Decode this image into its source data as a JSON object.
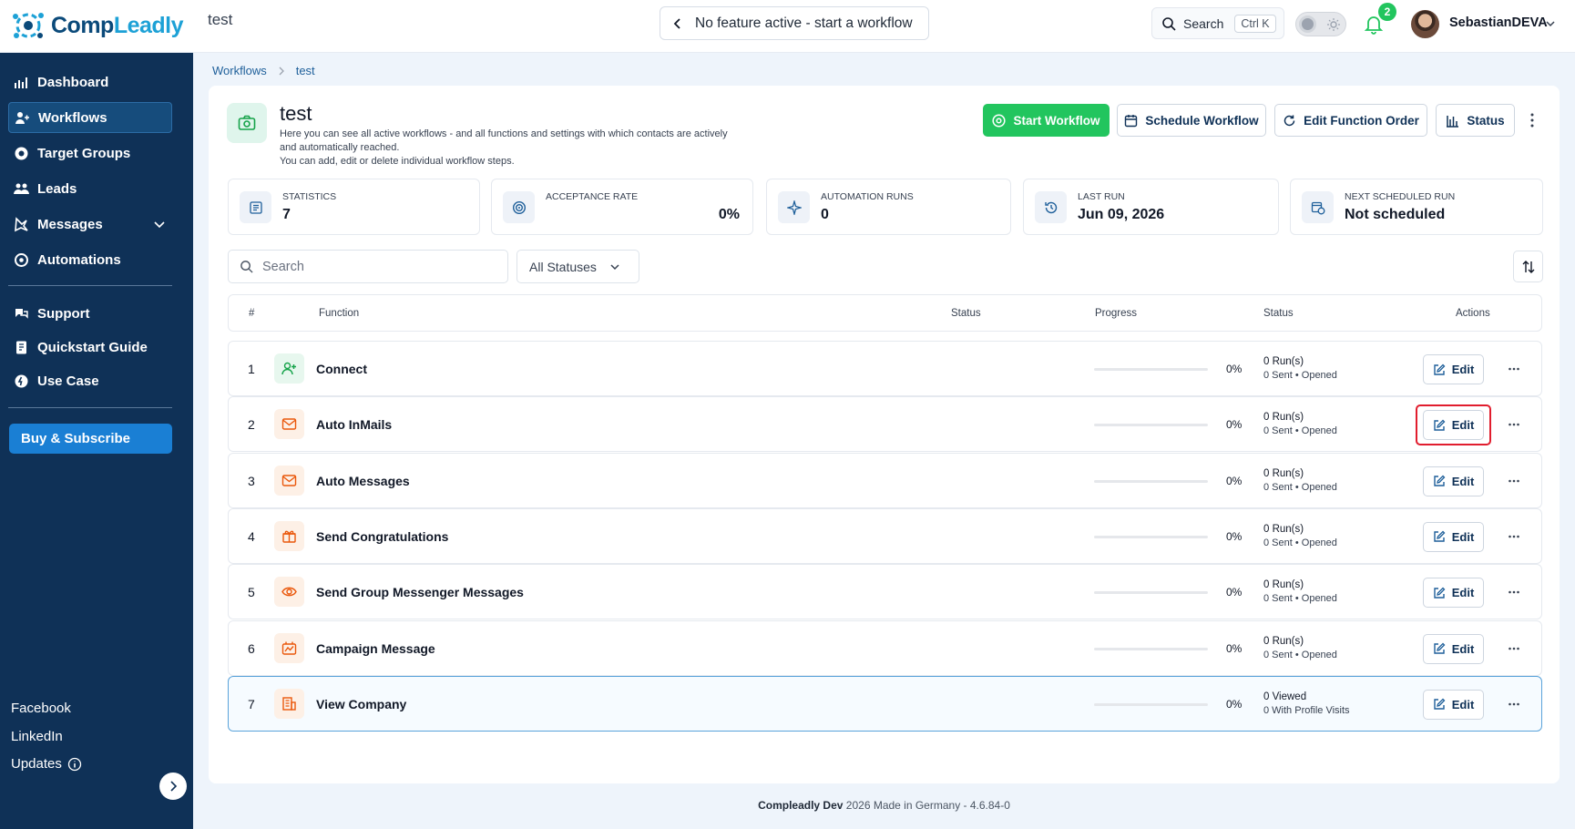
{
  "app": {
    "logo_prefix": "Comp",
    "logo_suffix": "Leadly",
    "page_name": "test"
  },
  "topbar": {
    "feature_status": "No feature active - start a workflow",
    "search_label": "Search",
    "search_shortcut": "Ctrl K",
    "notification_count": "2",
    "username": "SebastianDEVA"
  },
  "sidebar": {
    "items": [
      {
        "label": "Dashboard",
        "icon": "dashboard-icon"
      },
      {
        "label": "Workflows",
        "icon": "workflows-icon",
        "active": true
      },
      {
        "label": "Target Groups",
        "icon": "target-groups-icon"
      },
      {
        "label": "Leads",
        "icon": "leads-icon"
      },
      {
        "label": "Messages",
        "icon": "messages-icon"
      },
      {
        "label": "Automations",
        "icon": "automations-icon"
      }
    ],
    "help_items": [
      {
        "label": "Support"
      },
      {
        "label": "Quickstart Guide"
      },
      {
        "label": "Use Case"
      }
    ],
    "buy_label": "Buy & Subscribe",
    "footer_links": [
      {
        "label": "Facebook"
      },
      {
        "label": "LinkedIn"
      },
      {
        "label": "Updates"
      }
    ]
  },
  "breadcrumb": {
    "parent": "Workflows",
    "current": "test"
  },
  "workflow": {
    "title": "test",
    "description_line1": "Here you can see all active workflows - and all functions and settings with which contacts are actively",
    "description_line2": "and automatically reached.",
    "description_line3": "You can add, edit or delete individual workflow steps."
  },
  "actions": {
    "start": "Start Workflow",
    "schedule": "Schedule Workflow",
    "edit_order": "Edit Function Order",
    "status": "Status"
  },
  "stats": [
    {
      "label": "Statistics",
      "value": "7"
    },
    {
      "label": "Acceptance Rate",
      "value": "0%"
    },
    {
      "label": "Automation Runs",
      "value": "0"
    },
    {
      "label": "Last Run",
      "value": "Jun 09, 2026"
    },
    {
      "label": "Next Scheduled Run",
      "value": "Not scheduled"
    }
  ],
  "filters": {
    "search_placeholder": "Search",
    "status_selected": "All Statuses"
  },
  "table": {
    "headers": {
      "num": "#",
      "function": "Function",
      "status": "Status",
      "progress": "Progress",
      "status2": "Status",
      "actions": "Actions"
    },
    "edit_label": "Edit",
    "rows": [
      {
        "num": "1",
        "name": "Connect",
        "icon": "user-plus-icon",
        "tone": "green",
        "progress": 0,
        "pct": "0%",
        "line1": "0 Run(s)",
        "line2": "0 Sent • Opened"
      },
      {
        "num": "2",
        "name": "Auto InMails",
        "icon": "mail-icon",
        "tone": "orange",
        "progress": 0,
        "pct": "0%",
        "line1": "0 Run(s)",
        "line2": "0 Sent • Opened",
        "focused": true
      },
      {
        "num": "3",
        "name": "Auto Messages",
        "icon": "mail-icon",
        "tone": "orange",
        "progress": 0,
        "pct": "0%",
        "line1": "0 Run(s)",
        "line2": "0 Sent • Opened"
      },
      {
        "num": "4",
        "name": "Send Congratulations",
        "icon": "gift-icon",
        "tone": "orange",
        "progress": 0,
        "pct": "0%",
        "line1": "0 Run(s)",
        "line2": "0 Sent • Opened"
      },
      {
        "num": "5",
        "name": "Send Group Messenger Messages",
        "icon": "eye-icon",
        "tone": "orange",
        "progress": 0,
        "pct": "0%",
        "line1": "0 Run(s)",
        "line2": "0 Sent • Opened"
      },
      {
        "num": "6",
        "name": "Campaign Message",
        "icon": "campaign-icon",
        "tone": "orange",
        "progress": 0,
        "pct": "0%",
        "line1": "0 Run(s)",
        "line2": "0 Sent • Opened"
      },
      {
        "num": "7",
        "name": "View Company",
        "icon": "building-icon",
        "tone": "orange",
        "progress": 0,
        "pct": "0%",
        "line1": "0 Viewed",
        "line2": "0 With Profile Visits",
        "highlight": true
      }
    ]
  },
  "footer": {
    "brand": "Compleadly Dev",
    "text": "2026 Made in Germany - 4.6.84-0"
  },
  "colors": {
    "sidebar": "#0f3157",
    "accent": "#1a7fd4",
    "success": "#22c55e",
    "focus": "#e11d2e"
  }
}
